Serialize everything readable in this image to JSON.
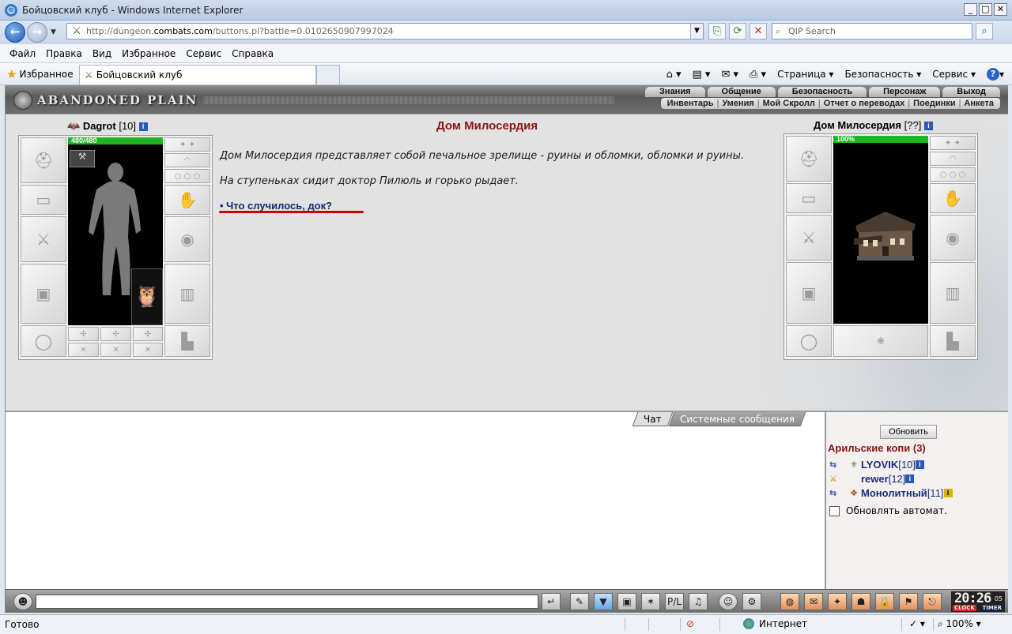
{
  "window": {
    "title": "Бойцовский клуб - Windows Internet Explorer"
  },
  "address": {
    "url_prefix": "http://dungeon.",
    "url_domain": "combats.com",
    "url_suffix": "/buttons.pl?battle=0.0102650907997024"
  },
  "search": {
    "placeholder": "QIP Search"
  },
  "menu": [
    "Файл",
    "Правка",
    "Вид",
    "Избранное",
    "Сервис",
    "Справка"
  ],
  "favbar": {
    "favorites_label": "Избранное",
    "tab_title": "Бойцовский клуб",
    "cmd": {
      "page": "Страница",
      "security": "Безопасность",
      "tools": "Сервис"
    }
  },
  "game": {
    "logo": "ABANDONED PLAIN",
    "top_menu": [
      "Знания",
      "Общение",
      "Безопасность",
      "Персонаж",
      "Выход"
    ],
    "sub_menu": [
      "Инвентарь",
      "Умения",
      "Мой Скролл",
      "Отчет о переводах",
      "Поединки",
      "Анкета"
    ],
    "player": {
      "name": "Dagrot",
      "level": "[10]",
      "hp": "480/480",
      "hp_fraction": 1.0
    },
    "location": {
      "title": "Дом Милосердия",
      "text1": "Дом Милосердия представляет собой печальное зрелище - руины и обломки, обломки и руины.",
      "text2": "На ступеньках сидит доктор Пилюль и горько рыдает.",
      "link": "• Что случилось, док?"
    },
    "npc": {
      "name": "Дом Милосердия",
      "level": "[??]",
      "hp": "100%",
      "hp_fraction": 1.0
    }
  },
  "chat": {
    "tabs": [
      "Чат",
      "Системные сообщения"
    ],
    "refresh_label": "Обновить",
    "room": "Арильские копи (3)",
    "users": [
      {
        "nick": "LYOVIK",
        "level": "[10]"
      },
      {
        "nick": "rewer",
        "level": "[12]"
      },
      {
        "nick": "Монолитный",
        "level": "[11]"
      }
    ],
    "auto_refresh_label": "Обновлять автомат."
  },
  "clock": {
    "time": "20:26",
    "seconds": "05",
    "label_clock": "CLOCK",
    "label_timer": "TIMER"
  },
  "status": {
    "ready": "Готово",
    "zone": "Интернет",
    "zoom": "100%"
  }
}
